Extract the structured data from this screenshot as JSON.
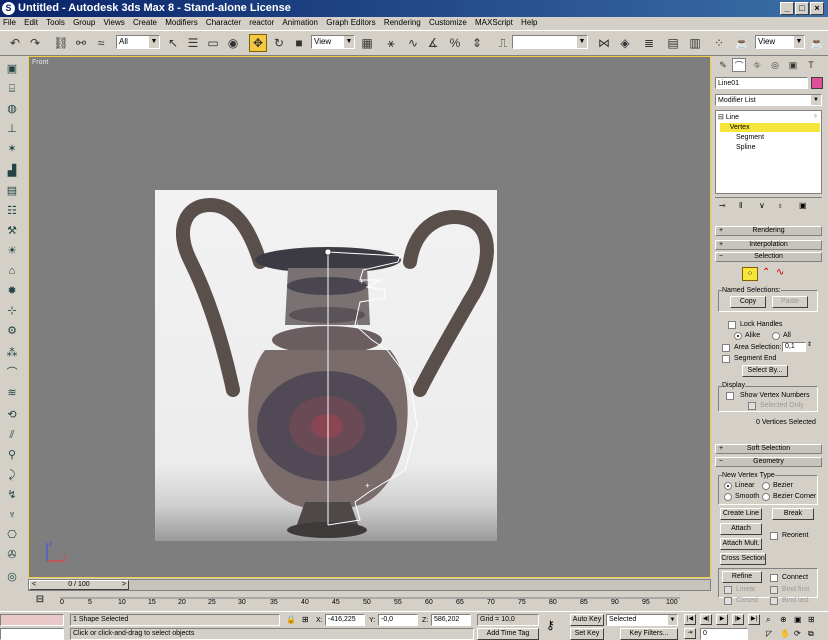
{
  "window": {
    "title": "Untitled - Autodesk 3ds Max 8 - Stand-alone License"
  },
  "menu": [
    "File",
    "Edit",
    "Tools",
    "Group",
    "Views",
    "Create",
    "Modifiers",
    "Character",
    "reactor",
    "Animation",
    "Graph Editors",
    "Rendering",
    "Customize",
    "MAXScript",
    "Help"
  ],
  "toolbar": {
    "selection_filter": "All",
    "reference_coord": "View",
    "named_selection": "",
    "render_view": "View"
  },
  "viewport": {
    "label": "Front"
  },
  "command_panel": {
    "object_name": "Line01",
    "object_color": "#e0509a",
    "modifier_list": "Modifier List",
    "stack": [
      "Line",
      "Vertex",
      "Segment",
      "Spline"
    ],
    "rollouts": {
      "rendering": "Rendering",
      "interpolation": "Interpolation",
      "selection": "Selection",
      "soft_selection": "Soft Selection",
      "geometry": "Geometry"
    },
    "selection": {
      "named_selections": "Named Selections:",
      "copy": "Copy",
      "paste": "Paste",
      "lock_handles": "Lock Handles",
      "alike": "Alike",
      "all": "All",
      "area_selection": "Area Selection:",
      "area_value": "0,1",
      "segment_end": "Segment End",
      "select_by": "Select By...",
      "display": "Display",
      "show_vertex_numbers": "Show Vertex Numbers",
      "selected_only": "Selected Only",
      "vertices_selected": "0 Vertices Selected"
    },
    "geometry": {
      "new_vertex_type": "New Vertex Type",
      "linear": "Linear",
      "bezier": "Bezier",
      "smooth": "Smooth",
      "bezier_corner": "Bezier Corner",
      "create_line": "Create Line",
      "break": "Break",
      "attach": "Attach",
      "attach_mult": "Attach Mult.",
      "reorient": "Reorient",
      "cross_section": "Cross Section",
      "refine": "Refine",
      "connect": "Connect",
      "linear_dis": "Linear",
      "bind_first": "Bind first",
      "closed": "Closed",
      "bind_last": "Bind last"
    }
  },
  "timeline": {
    "slider": "0 / 100",
    "ticks": [
      "0",
      "5",
      "10",
      "15",
      "20",
      "25",
      "30",
      "35",
      "40",
      "45",
      "50",
      "55",
      "60",
      "65",
      "70",
      "75",
      "80",
      "85",
      "90",
      "95",
      "100"
    ]
  },
  "status": {
    "selected": "1 Shape Selected",
    "prompt": "Click or click-and-drag to select objects",
    "x_label": "X:",
    "x": "-416,225",
    "y_label": "Y:",
    "y": "-0,0",
    "z_label": "Z:",
    "z": "586,202",
    "grid": "Grid = 10,0",
    "add_time_tag": "Add Time Tag",
    "auto_key": "Auto Key",
    "set_key": "Set Key",
    "key_mode": "Selected",
    "key_filters": "Key Filters...",
    "frame": "0"
  }
}
